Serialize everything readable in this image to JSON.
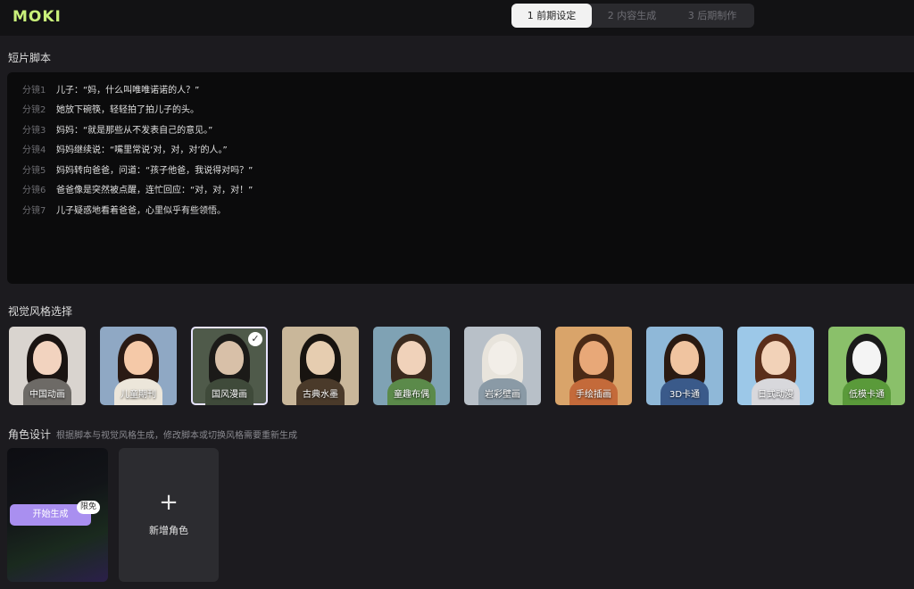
{
  "app": {
    "logo": "MOKI"
  },
  "steps": [
    {
      "label": "1 前期设定",
      "active": true
    },
    {
      "label": "2 内容生成",
      "active": false
    },
    {
      "label": "3 后期制作",
      "active": false
    }
  ],
  "script_section": {
    "title": "短片脚本",
    "lines": [
      {
        "shot": "分镜1",
        "text": "儿子：“妈，什么叫唯唯诺诺的人？”"
      },
      {
        "shot": "分镜2",
        "text": "她放下碗筷，轻轻拍了拍儿子的头。"
      },
      {
        "shot": "分镜3",
        "text": "妈妈：“就是那些从不发表自己的意见。”"
      },
      {
        "shot": "分镜4",
        "text": "妈妈继续说：“嘴里常说‘对，对，对’的人。”"
      },
      {
        "shot": "分镜5",
        "text": "妈妈转向爸爸，问道：“孩子他爸，我说得对吗？”"
      },
      {
        "shot": "分镜6",
        "text": "爸爸像是突然被点醒，连忙回应：“对，对，对！”"
      },
      {
        "shot": "分镜7",
        "text": "儿子疑惑地看着爸爸，心里似乎有些领悟。"
      }
    ]
  },
  "style_section": {
    "title": "视觉风格选择",
    "styles": [
      {
        "label": "中国动画",
        "selected": false,
        "bg": "#d9d4cf",
        "hair": "#1a1412",
        "skin": "#f2d3bf",
        "cloth": "#6d6a66"
      },
      {
        "label": "儿童期刊",
        "selected": false,
        "bg": "#8fa8c4",
        "hair": "#2a1a14",
        "skin": "#f5c9a8",
        "cloth": "#ece6da"
      },
      {
        "label": "国风漫画",
        "selected": true,
        "bg": "#4f5a4a",
        "hair": "#1b1a18",
        "skin": "#d8c0a8",
        "cloth": "#3f4a3a"
      },
      {
        "label": "古典水墨",
        "selected": false,
        "bg": "#c9b79a",
        "hair": "#181410",
        "skin": "#e6cdb0",
        "cloth": "#4a3a2a"
      },
      {
        "label": "童趣布偶",
        "selected": false,
        "bg": "#7fa2b4",
        "hair": "#3a2a1e",
        "skin": "#f0d2ba",
        "cloth": "#5b8a4a"
      },
      {
        "label": "岩彩壁画",
        "selected": false,
        "bg": "#b8c0c8",
        "hair": "#e8e4dc",
        "skin": "#f2eee8",
        "cloth": "#8a9aa6"
      },
      {
        "label": "手绘插画",
        "selected": false,
        "bg": "#d9a46a",
        "hair": "#4a2a16",
        "skin": "#e8a878",
        "cloth": "#c46a3a"
      },
      {
        "label": "3D卡通",
        "selected": false,
        "bg": "#8fb8d8",
        "hair": "#2a1a12",
        "skin": "#f0c4a0",
        "cloth": "#3a5a8a"
      },
      {
        "label": "日式动漫",
        "selected": false,
        "bg": "#9cc8e8",
        "hair": "#5a2e1a",
        "skin": "#f2d2b8",
        "cloth": "#d8d8dc"
      },
      {
        "label": "低模卡通",
        "selected": false,
        "bg": "#8ac06a",
        "hair": "#1a1a1a",
        "skin": "#f4f4f4",
        "cloth": "#5a9a3a"
      }
    ]
  },
  "character_section": {
    "title": "角色设计",
    "note": "根据脚本与视觉风格生成，修改脚本或切换风格需要重新生成",
    "generate_button": "开始生成",
    "free_badge": "限免",
    "add_label": "新增角色",
    "add_icon": "plus-icon"
  },
  "colors": {
    "accent": "#a98ff0",
    "logo": "#c9f07a",
    "background": "#1c1b1f"
  }
}
